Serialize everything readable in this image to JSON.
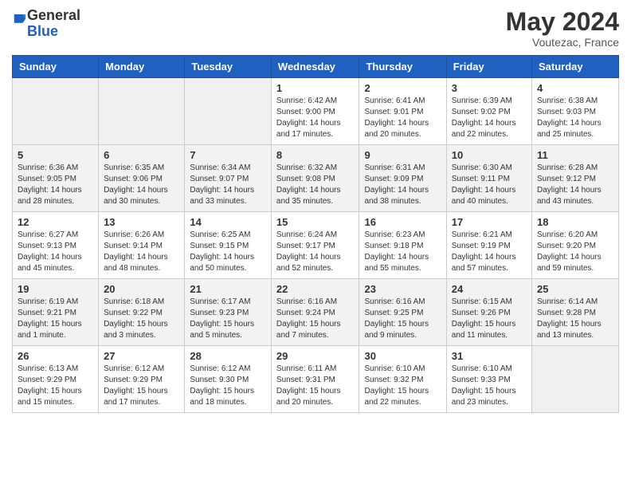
{
  "header": {
    "logo_general": "General",
    "logo_blue": "Blue",
    "month_title": "May 2024",
    "location": "Voutezac, France"
  },
  "days_of_week": [
    "Sunday",
    "Monday",
    "Tuesday",
    "Wednesday",
    "Thursday",
    "Friday",
    "Saturday"
  ],
  "weeks": [
    [
      {
        "day": "",
        "sunrise": "",
        "sunset": "",
        "daylight": ""
      },
      {
        "day": "",
        "sunrise": "",
        "sunset": "",
        "daylight": ""
      },
      {
        "day": "",
        "sunrise": "",
        "sunset": "",
        "daylight": ""
      },
      {
        "day": "1",
        "sunrise": "Sunrise: 6:42 AM",
        "sunset": "Sunset: 9:00 PM",
        "daylight": "Daylight: 14 hours and 17 minutes."
      },
      {
        "day": "2",
        "sunrise": "Sunrise: 6:41 AM",
        "sunset": "Sunset: 9:01 PM",
        "daylight": "Daylight: 14 hours and 20 minutes."
      },
      {
        "day": "3",
        "sunrise": "Sunrise: 6:39 AM",
        "sunset": "Sunset: 9:02 PM",
        "daylight": "Daylight: 14 hours and 22 minutes."
      },
      {
        "day": "4",
        "sunrise": "Sunrise: 6:38 AM",
        "sunset": "Sunset: 9:03 PM",
        "daylight": "Daylight: 14 hours and 25 minutes."
      }
    ],
    [
      {
        "day": "5",
        "sunrise": "Sunrise: 6:36 AM",
        "sunset": "Sunset: 9:05 PM",
        "daylight": "Daylight: 14 hours and 28 minutes."
      },
      {
        "day": "6",
        "sunrise": "Sunrise: 6:35 AM",
        "sunset": "Sunset: 9:06 PM",
        "daylight": "Daylight: 14 hours and 30 minutes."
      },
      {
        "day": "7",
        "sunrise": "Sunrise: 6:34 AM",
        "sunset": "Sunset: 9:07 PM",
        "daylight": "Daylight: 14 hours and 33 minutes."
      },
      {
        "day": "8",
        "sunrise": "Sunrise: 6:32 AM",
        "sunset": "Sunset: 9:08 PM",
        "daylight": "Daylight: 14 hours and 35 minutes."
      },
      {
        "day": "9",
        "sunrise": "Sunrise: 6:31 AM",
        "sunset": "Sunset: 9:09 PM",
        "daylight": "Daylight: 14 hours and 38 minutes."
      },
      {
        "day": "10",
        "sunrise": "Sunrise: 6:30 AM",
        "sunset": "Sunset: 9:11 PM",
        "daylight": "Daylight: 14 hours and 40 minutes."
      },
      {
        "day": "11",
        "sunrise": "Sunrise: 6:28 AM",
        "sunset": "Sunset: 9:12 PM",
        "daylight": "Daylight: 14 hours and 43 minutes."
      }
    ],
    [
      {
        "day": "12",
        "sunrise": "Sunrise: 6:27 AM",
        "sunset": "Sunset: 9:13 PM",
        "daylight": "Daylight: 14 hours and 45 minutes."
      },
      {
        "day": "13",
        "sunrise": "Sunrise: 6:26 AM",
        "sunset": "Sunset: 9:14 PM",
        "daylight": "Daylight: 14 hours and 48 minutes."
      },
      {
        "day": "14",
        "sunrise": "Sunrise: 6:25 AM",
        "sunset": "Sunset: 9:15 PM",
        "daylight": "Daylight: 14 hours and 50 minutes."
      },
      {
        "day": "15",
        "sunrise": "Sunrise: 6:24 AM",
        "sunset": "Sunset: 9:17 PM",
        "daylight": "Daylight: 14 hours and 52 minutes."
      },
      {
        "day": "16",
        "sunrise": "Sunrise: 6:23 AM",
        "sunset": "Sunset: 9:18 PM",
        "daylight": "Daylight: 14 hours and 55 minutes."
      },
      {
        "day": "17",
        "sunrise": "Sunrise: 6:21 AM",
        "sunset": "Sunset: 9:19 PM",
        "daylight": "Daylight: 14 hours and 57 minutes."
      },
      {
        "day": "18",
        "sunrise": "Sunrise: 6:20 AM",
        "sunset": "Sunset: 9:20 PM",
        "daylight": "Daylight: 14 hours and 59 minutes."
      }
    ],
    [
      {
        "day": "19",
        "sunrise": "Sunrise: 6:19 AM",
        "sunset": "Sunset: 9:21 PM",
        "daylight": "Daylight: 15 hours and 1 minute."
      },
      {
        "day": "20",
        "sunrise": "Sunrise: 6:18 AM",
        "sunset": "Sunset: 9:22 PM",
        "daylight": "Daylight: 15 hours and 3 minutes."
      },
      {
        "day": "21",
        "sunrise": "Sunrise: 6:17 AM",
        "sunset": "Sunset: 9:23 PM",
        "daylight": "Daylight: 15 hours and 5 minutes."
      },
      {
        "day": "22",
        "sunrise": "Sunrise: 6:16 AM",
        "sunset": "Sunset: 9:24 PM",
        "daylight": "Daylight: 15 hours and 7 minutes."
      },
      {
        "day": "23",
        "sunrise": "Sunrise: 6:16 AM",
        "sunset": "Sunset: 9:25 PM",
        "daylight": "Daylight: 15 hours and 9 minutes."
      },
      {
        "day": "24",
        "sunrise": "Sunrise: 6:15 AM",
        "sunset": "Sunset: 9:26 PM",
        "daylight": "Daylight: 15 hours and 11 minutes."
      },
      {
        "day": "25",
        "sunrise": "Sunrise: 6:14 AM",
        "sunset": "Sunset: 9:28 PM",
        "daylight": "Daylight: 15 hours and 13 minutes."
      }
    ],
    [
      {
        "day": "26",
        "sunrise": "Sunrise: 6:13 AM",
        "sunset": "Sunset: 9:29 PM",
        "daylight": "Daylight: 15 hours and 15 minutes."
      },
      {
        "day": "27",
        "sunrise": "Sunrise: 6:12 AM",
        "sunset": "Sunset: 9:29 PM",
        "daylight": "Daylight: 15 hours and 17 minutes."
      },
      {
        "day": "28",
        "sunrise": "Sunrise: 6:12 AM",
        "sunset": "Sunset: 9:30 PM",
        "daylight": "Daylight: 15 hours and 18 minutes."
      },
      {
        "day": "29",
        "sunrise": "Sunrise: 6:11 AM",
        "sunset": "Sunset: 9:31 PM",
        "daylight": "Daylight: 15 hours and 20 minutes."
      },
      {
        "day": "30",
        "sunrise": "Sunrise: 6:10 AM",
        "sunset": "Sunset: 9:32 PM",
        "daylight": "Daylight: 15 hours and 22 minutes."
      },
      {
        "day": "31",
        "sunrise": "Sunrise: 6:10 AM",
        "sunset": "Sunset: 9:33 PM",
        "daylight": "Daylight: 15 hours and 23 minutes."
      },
      {
        "day": "",
        "sunrise": "",
        "sunset": "",
        "daylight": ""
      }
    ]
  ]
}
